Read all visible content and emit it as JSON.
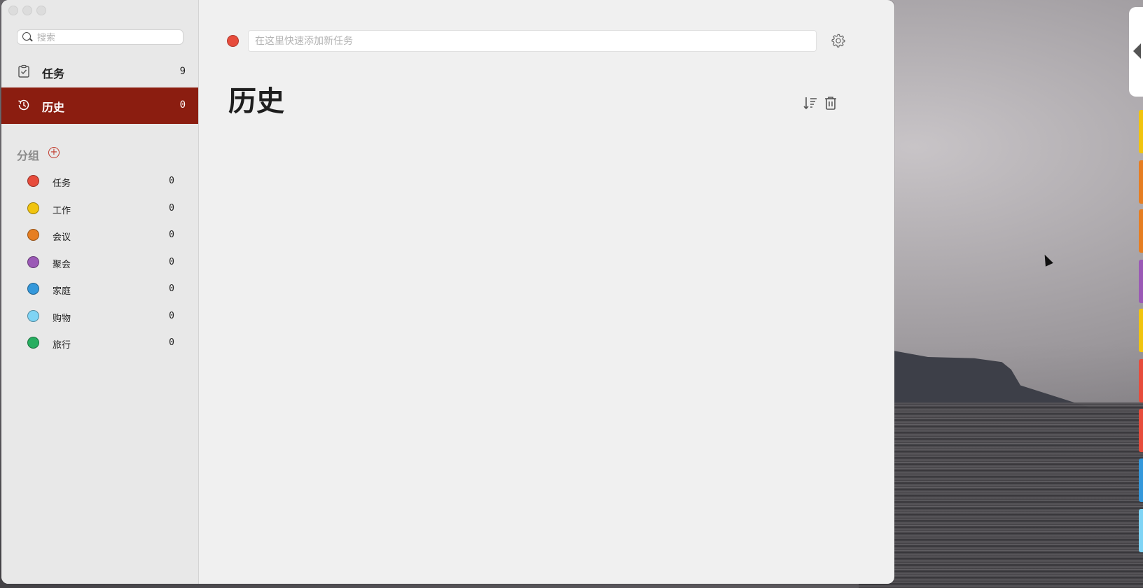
{
  "search": {
    "placeholder": "搜索",
    "value": ""
  },
  "nav": [
    {
      "label": "任务",
      "count": "9",
      "icon": "clipboard-check-icon"
    },
    {
      "label": "历史",
      "count": "0",
      "icon": "history-icon",
      "active": true
    }
  ],
  "groups": {
    "header": "分组",
    "add_label": "+",
    "items": [
      {
        "name": "任务",
        "count": "0",
        "color": "#e74c3c"
      },
      {
        "name": "工作",
        "count": "0",
        "color": "#f1c40f"
      },
      {
        "name": "会议",
        "count": "0",
        "color": "#e67e22"
      },
      {
        "name": "聚会",
        "count": "0",
        "color": "#9b59b6"
      },
      {
        "name": "家庭",
        "count": "0",
        "color": "#3498db"
      },
      {
        "name": "购物",
        "count": "0",
        "color": "#7fd4f5"
      },
      {
        "name": "旅行",
        "count": "0",
        "color": "#27ae60"
      }
    ]
  },
  "quick_add": {
    "placeholder": "在这里快速添加新任务",
    "value": "",
    "color": "#e74c3c"
  },
  "main": {
    "title": "历史"
  },
  "accent_color": "#8b1d10",
  "edge_tabs": [
    "#f1c40f",
    "#e67e22",
    "#e67e22",
    "#9b59b6",
    "#f1c40f",
    "#e74c3c",
    "#e74c3c",
    "#3498db",
    "#7fd4f5"
  ]
}
